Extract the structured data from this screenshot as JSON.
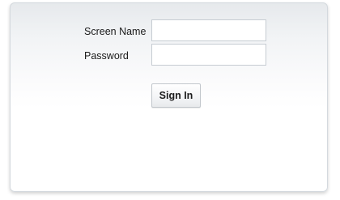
{
  "login_form": {
    "screen_name": {
      "label": "Screen Name",
      "value": "",
      "placeholder": ""
    },
    "password": {
      "label": "Password",
      "value": "",
      "placeholder": ""
    },
    "submit_label": "Sign In"
  },
  "colors": {
    "panel_border": "#d4d9de",
    "panel_top": "#e6e9ec",
    "panel_bottom": "#ffffff",
    "input_border": "#c6ccd2",
    "button_border": "#c2c7cc",
    "text": "#1a1a1a"
  }
}
